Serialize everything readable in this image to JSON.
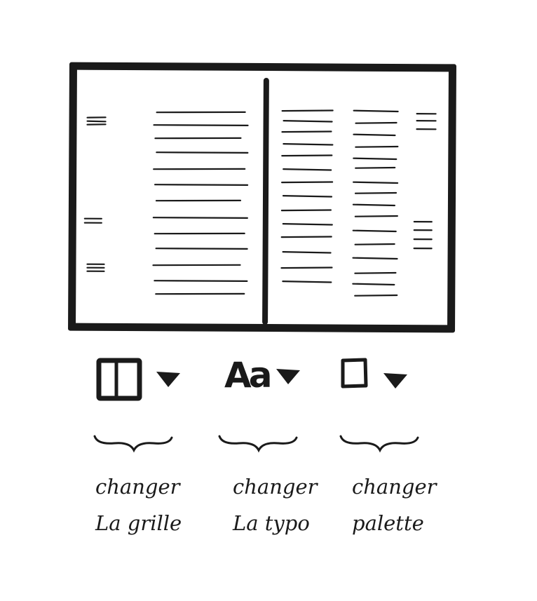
{
  "diagram": {
    "toolbar": {
      "grid_icon": "book-grid-icon",
      "typo_icon_text": "Aa",
      "palette_icon": "square-swatch-icon",
      "dropdown_icon": "triangle-down-icon"
    },
    "captions": {
      "grid": [
        "changer",
        "La grille"
      ],
      "typo": [
        "changer",
        "La typo"
      ],
      "palette": [
        "changer",
        "palette"
      ]
    },
    "colors": {
      "ink": "#1a1a1a",
      "paper": "#ffffff"
    }
  }
}
